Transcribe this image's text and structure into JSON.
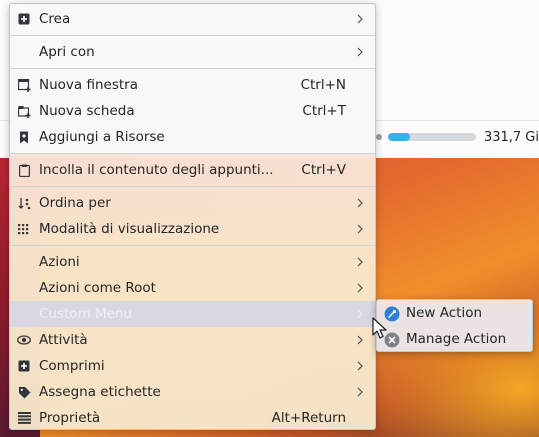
{
  "status_bar": {
    "free_space_label": "331,7 Gi",
    "free_space_fraction": 0.25
  },
  "context_menu": {
    "items": [
      {
        "label": "Crea",
        "icon": "plus-square-icon",
        "submenu": true
      },
      {
        "label": "Apri con",
        "icon": "",
        "submenu": true
      },
      {
        "label": "Nuova finestra",
        "icon": "new-window-icon",
        "shortcut": "Ctrl+N"
      },
      {
        "label": "Nuova scheda",
        "icon": "new-tab-icon",
        "shortcut": "Ctrl+T"
      },
      {
        "label": "Aggiungi a Risorse",
        "icon": "bookmark-icon"
      },
      {
        "label": "Incolla il contenuto degli appunti...",
        "icon": "clipboard-icon",
        "shortcut": "Ctrl+V"
      },
      {
        "label": "Ordina per",
        "icon": "sort-icon",
        "submenu": true
      },
      {
        "label": "Modalità di visualizzazione",
        "icon": "view-mode-icon",
        "submenu": true
      },
      {
        "label": "Azioni",
        "icon": "",
        "submenu": true
      },
      {
        "label": "Azioni come Root",
        "icon": "",
        "submenu": true
      },
      {
        "label": "Custom Menu",
        "icon": "",
        "submenu": true,
        "highlighted": true
      },
      {
        "label": "Attività",
        "icon": "activities-icon",
        "submenu": true
      },
      {
        "label": "Comprimi",
        "icon": "compress-icon",
        "submenu": true
      },
      {
        "label": "Assegna etichette",
        "icon": "tag-icon",
        "submenu": true
      },
      {
        "label": "Proprietà",
        "icon": "properties-icon",
        "shortcut": "Alt+Return"
      }
    ]
  },
  "submenu": {
    "items": [
      {
        "label": "New Action",
        "icon": "new-action-icon"
      },
      {
        "label": "Manage Action",
        "icon": "manage-action-icon"
      }
    ]
  },
  "colors": {
    "accent": "#3daee9",
    "highlight": "#d2d5e6"
  }
}
